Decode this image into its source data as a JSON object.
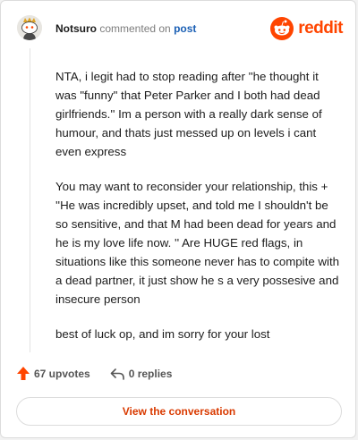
{
  "header": {
    "username": "Notsuro",
    "action_text": "commented on",
    "target_text": "post"
  },
  "brand": {
    "name": "reddit",
    "color": "#ff4500"
  },
  "comment": {
    "paragraphs": [
      "NTA, i legit had to stop reading after ''he thought it was \"funny\" that Peter Parker and I both had dead girlfriends.'' Im a person with a really dark sense of humour, and thats just messed up on levels i cant even express",
      "You may want to reconsider your relationship, this + ''He was incredibly upset, and told me I shouldn't be so sensitive, and that M had been dead for years and he is my love life now. '' Are HUGE red flags, in situations like this someone never has to compite with a dead partner, it just show he s a very possesive and insecure person",
      "best of luck op, and im sorry for your lost"
    ]
  },
  "actions": {
    "upvotes_label": "67 upvotes",
    "replies_label": "0 replies"
  },
  "cta": {
    "label": "View the conversation"
  },
  "icons": {
    "avatar": "snoo-avatar-icon",
    "brand": "reddit-logo-icon",
    "upvote": "upvote-arrow-icon",
    "reply": "reply-arrow-icon"
  }
}
